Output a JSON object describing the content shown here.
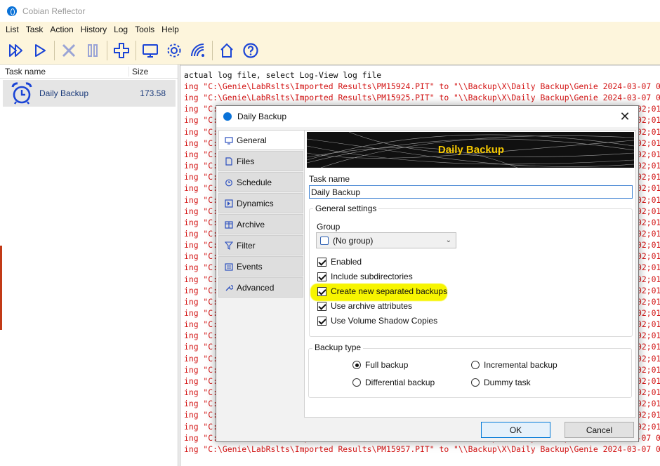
{
  "window": {
    "title": "Cobian Reflector"
  },
  "menu": [
    "List",
    "Task",
    "Action",
    "History",
    "Log",
    "Tools",
    "Help"
  ],
  "toolbar": [
    {
      "name": "run-all-icon",
      "color": "#1a44d6"
    },
    {
      "name": "run-icon",
      "color": "#1a44d6"
    },
    {
      "name": "abort-icon",
      "color": "#9aa4d6"
    },
    {
      "name": "pause-icon",
      "color": "#9aa4d6"
    },
    {
      "name": "add-task-icon",
      "color": "#1a44d6"
    },
    {
      "name": "monitor-icon",
      "color": "#1a44d6"
    },
    {
      "name": "settings-gear-icon",
      "color": "#1a44d6"
    },
    {
      "name": "network-icon",
      "color": "#1a44d6"
    },
    {
      "name": "home-icon",
      "color": "#1a44d6"
    },
    {
      "name": "help-icon",
      "color": "#1a44d6"
    }
  ],
  "tasks": {
    "columns": [
      "Task name",
      "Size"
    ],
    "rows": [
      {
        "name": "Daily Backup",
        "size": "173.58"
      }
    ]
  },
  "log": {
    "first_line": "actual log file, select Log-View log file",
    "lines": [
      "ing \"C:\\Genie\\LabRslts\\Imported Results\\PM15924.PIT\" to \"\\\\Backup\\X\\Daily Backup\\Genie 2024-03-07 02;01",
      "ing \"C:\\Genie\\LabRslts\\Imported Results\\PM15925.PIT\" to \"\\\\Backup\\X\\Daily Backup\\Genie 2024-03-07 02;01",
      "ing \"C:\\",
      "ing \"C:\\",
      "ing \"C:\\",
      "ing \"C:\\",
      "ing \"C:\\",
      "ing \"C:\\",
      "ing \"C:\\",
      "ing \"C:\\",
      "ing \"C:\\",
      "ing \"C:\\",
      "ing \"C:\\",
      "ing \"C:\\",
      "ing \"C:\\",
      "ing \"C:\\",
      "ing \"C:\\",
      "ing \"C:\\",
      "ing \"C:\\",
      "ing \"C:\\",
      "ing \"C:\\",
      "ing \"C:\\",
      "ing \"C:\\",
      "ing \"C:\\",
      "ing \"C:\\",
      "ing \"C:\\",
      "ing \"C:\\",
      "ing \"C:\\",
      "ing \"C:\\",
      "ing \"C:\\",
      "ing \"C:\\",
      "ing \"C:\\Genie\\LabRslts\\Imported Results\\PM15956.PIT\" to \"\\\\Backup\\X\\Daily Backup\\Genie 2024-03-07 02;01",
      "ing \"C:\\Genie\\LabRslts\\Imported Results\\PM15957.PIT\" to \"\\\\Backup\\X\\Daily Backup\\Genie 2024-03-07 02;01"
    ],
    "right_tail": "02;01",
    "colors": {
      "normal": "#111111",
      "copy": "#d31515"
    }
  },
  "dialog": {
    "title": "Daily Backup",
    "close": "✕",
    "tabs": [
      "General",
      "Files",
      "Schedule",
      "Dynamics",
      "Archive",
      "Filter",
      "Events",
      "Advanced"
    ],
    "banner_title": "Daily Backup",
    "task_name_label": "Task name",
    "task_name_value": "Daily Backup",
    "general_settings": {
      "title": "General settings",
      "group_label": "Group",
      "group_value": "(No group)",
      "checkboxes": [
        {
          "label": "Enabled",
          "checked": true
        },
        {
          "label": "Include subdirectories",
          "checked": true
        },
        {
          "label": "Create new separated backups",
          "checked": true,
          "highlighted": true
        },
        {
          "label": "Use archive attributes",
          "checked": true
        },
        {
          "label": "Use Volume Shadow Copies",
          "checked": true
        }
      ]
    },
    "backup_type": {
      "title": "Backup type",
      "options": [
        {
          "label": "Full backup",
          "selected": true
        },
        {
          "label": "Incremental backup",
          "selected": false
        },
        {
          "label": "Differential backup",
          "selected": false
        },
        {
          "label": "Dummy task",
          "selected": false
        }
      ]
    },
    "ok": "OK",
    "cancel": "Cancel"
  }
}
